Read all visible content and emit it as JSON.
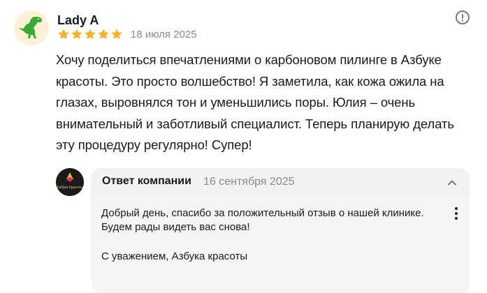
{
  "review": {
    "author": "Lady A",
    "rating": 5,
    "rating_max": 5,
    "date": "18 июля 2025",
    "text": "Хочу поделиться впечатлениями о карбоновом пилинге в Азбуке красоты. Это просто волшебство! Я заметила, как кожа ожила на глазах, выровнялся тон и уменьшились поры. Юлия – очень внимательный и заботливый специалист. Теперь планирую делать эту процедуру регулярно! Супер!"
  },
  "reply": {
    "title": "Ответ компании",
    "date": "16 сентября 2025",
    "text": "Добрый день, спасибо за положительный отзыв о нашей клинике. Будем рады видеть вас снова!",
    "signature": "С уважением, Азбука красоты",
    "logo_text": "Азбука Красоты"
  },
  "colors": {
    "star": "#f5b324",
    "muted": "#8a8a8a",
    "reply_bg": "#f2f2f2"
  },
  "icons": {
    "avatar": "green-dinosaur-icon",
    "report": "exclamation-circle-icon",
    "collapse": "chevron-up-icon",
    "menu": "kebab-menu-icon"
  }
}
